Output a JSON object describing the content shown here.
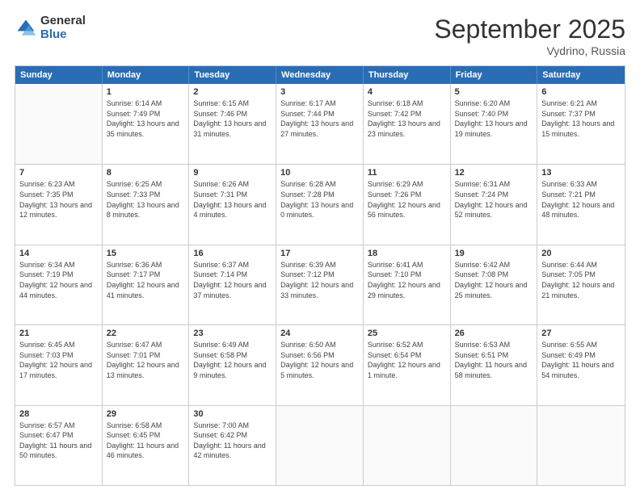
{
  "logo": {
    "general": "General",
    "blue": "Blue"
  },
  "title": "September 2025",
  "subtitle": "Vydrino, Russia",
  "days": [
    "Sunday",
    "Monday",
    "Tuesday",
    "Wednesday",
    "Thursday",
    "Friday",
    "Saturday"
  ],
  "weeks": [
    [
      {
        "empty": true
      },
      {
        "day": 1,
        "sunrise": "6:14 AM",
        "sunset": "7:49 PM",
        "daylight": "13 hours and 35 minutes."
      },
      {
        "day": 2,
        "sunrise": "6:15 AM",
        "sunset": "7:46 PM",
        "daylight": "13 hours and 31 minutes."
      },
      {
        "day": 3,
        "sunrise": "6:17 AM",
        "sunset": "7:44 PM",
        "daylight": "13 hours and 27 minutes."
      },
      {
        "day": 4,
        "sunrise": "6:18 AM",
        "sunset": "7:42 PM",
        "daylight": "13 hours and 23 minutes."
      },
      {
        "day": 5,
        "sunrise": "6:20 AM",
        "sunset": "7:40 PM",
        "daylight": "13 hours and 19 minutes."
      },
      {
        "day": 6,
        "sunrise": "6:21 AM",
        "sunset": "7:37 PM",
        "daylight": "13 hours and 15 minutes."
      }
    ],
    [
      {
        "day": 7,
        "sunrise": "6:23 AM",
        "sunset": "7:35 PM",
        "daylight": "13 hours and 12 minutes."
      },
      {
        "day": 8,
        "sunrise": "6:25 AM",
        "sunset": "7:33 PM",
        "daylight": "13 hours and 8 minutes."
      },
      {
        "day": 9,
        "sunrise": "6:26 AM",
        "sunset": "7:31 PM",
        "daylight": "13 hours and 4 minutes."
      },
      {
        "day": 10,
        "sunrise": "6:28 AM",
        "sunset": "7:28 PM",
        "daylight": "13 hours and 0 minutes."
      },
      {
        "day": 11,
        "sunrise": "6:29 AM",
        "sunset": "7:26 PM",
        "daylight": "12 hours and 56 minutes."
      },
      {
        "day": 12,
        "sunrise": "6:31 AM",
        "sunset": "7:24 PM",
        "daylight": "12 hours and 52 minutes."
      },
      {
        "day": 13,
        "sunrise": "6:33 AM",
        "sunset": "7:21 PM",
        "daylight": "12 hours and 48 minutes."
      }
    ],
    [
      {
        "day": 14,
        "sunrise": "6:34 AM",
        "sunset": "7:19 PM",
        "daylight": "12 hours and 44 minutes."
      },
      {
        "day": 15,
        "sunrise": "6:36 AM",
        "sunset": "7:17 PM",
        "daylight": "12 hours and 41 minutes."
      },
      {
        "day": 16,
        "sunrise": "6:37 AM",
        "sunset": "7:14 PM",
        "daylight": "12 hours and 37 minutes."
      },
      {
        "day": 17,
        "sunrise": "6:39 AM",
        "sunset": "7:12 PM",
        "daylight": "12 hours and 33 minutes."
      },
      {
        "day": 18,
        "sunrise": "6:41 AM",
        "sunset": "7:10 PM",
        "daylight": "12 hours and 29 minutes."
      },
      {
        "day": 19,
        "sunrise": "6:42 AM",
        "sunset": "7:08 PM",
        "daylight": "12 hours and 25 minutes."
      },
      {
        "day": 20,
        "sunrise": "6:44 AM",
        "sunset": "7:05 PM",
        "daylight": "12 hours and 21 minutes."
      }
    ],
    [
      {
        "day": 21,
        "sunrise": "6:45 AM",
        "sunset": "7:03 PM",
        "daylight": "12 hours and 17 minutes."
      },
      {
        "day": 22,
        "sunrise": "6:47 AM",
        "sunset": "7:01 PM",
        "daylight": "12 hours and 13 minutes."
      },
      {
        "day": 23,
        "sunrise": "6:49 AM",
        "sunset": "6:58 PM",
        "daylight": "12 hours and 9 minutes."
      },
      {
        "day": 24,
        "sunrise": "6:50 AM",
        "sunset": "6:56 PM",
        "daylight": "12 hours and 5 minutes."
      },
      {
        "day": 25,
        "sunrise": "6:52 AM",
        "sunset": "6:54 PM",
        "daylight": "12 hours and 1 minute."
      },
      {
        "day": 26,
        "sunrise": "6:53 AM",
        "sunset": "6:51 PM",
        "daylight": "11 hours and 58 minutes."
      },
      {
        "day": 27,
        "sunrise": "6:55 AM",
        "sunset": "6:49 PM",
        "daylight": "11 hours and 54 minutes."
      }
    ],
    [
      {
        "day": 28,
        "sunrise": "6:57 AM",
        "sunset": "6:47 PM",
        "daylight": "11 hours and 50 minutes."
      },
      {
        "day": 29,
        "sunrise": "6:58 AM",
        "sunset": "6:45 PM",
        "daylight": "11 hours and 46 minutes."
      },
      {
        "day": 30,
        "sunrise": "7:00 AM",
        "sunset": "6:42 PM",
        "daylight": "11 hours and 42 minutes."
      },
      {
        "empty": true
      },
      {
        "empty": true
      },
      {
        "empty": true
      },
      {
        "empty": true
      }
    ]
  ]
}
